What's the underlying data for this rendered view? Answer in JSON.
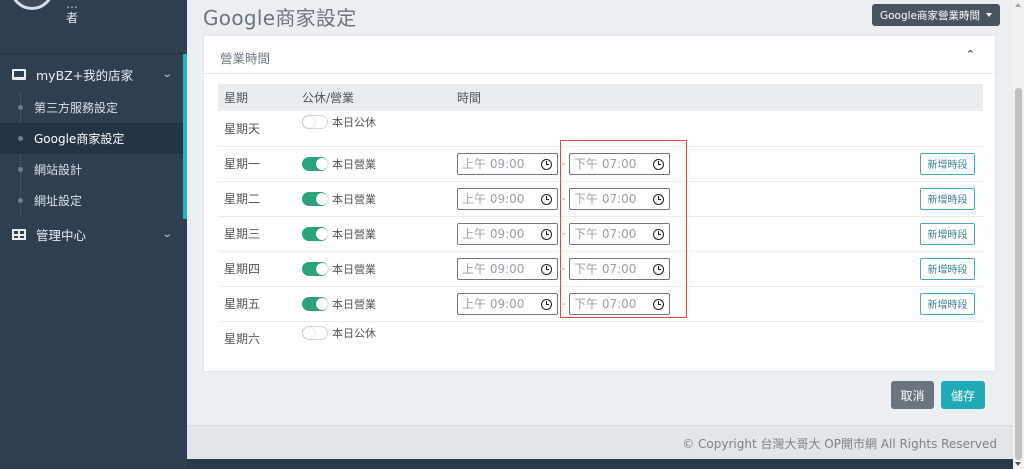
{
  "sidebar": {
    "profile_name": "…",
    "profile_role": "者",
    "groups": [
      {
        "label": "myBZ+我的店家",
        "icon": "monitor-icon"
      },
      {
        "label": "管理中心",
        "icon": "table-icon"
      }
    ],
    "sub_items": [
      "第三方服務設定",
      "Google商家設定",
      "網站設計",
      "網址設定"
    ],
    "active_item": "Google商家設定"
  },
  "header": {
    "title": "Google商家設定",
    "dropdown_label": "Google商家營業時間"
  },
  "panel": {
    "title": "營業時間",
    "collapse_icon": "chevron-up-icon",
    "columns": [
      "星期",
      "公休/營業",
      "時間"
    ],
    "rows": [
      {
        "day": "星期天",
        "open": false,
        "status": "本日公休"
      },
      {
        "day": "星期一",
        "open": true,
        "status": "本日營業",
        "start": "上午 09:00",
        "end": "下午 07:00",
        "add_label": "新增時段"
      },
      {
        "day": "星期二",
        "open": true,
        "status": "本日營業",
        "start": "上午 09:00",
        "end": "下午 07:00",
        "add_label": "新增時段"
      },
      {
        "day": "星期三",
        "open": true,
        "status": "本日營業",
        "start": "上午 09:00",
        "end": "下午 07:00",
        "add_label": "新增時段"
      },
      {
        "day": "星期四",
        "open": true,
        "status": "本日營業",
        "start": "上午 09:00",
        "end": "下午 07:00",
        "add_label": "新增時段"
      },
      {
        "day": "星期五",
        "open": true,
        "status": "本日營業",
        "start": "上午 09:00",
        "end": "下午 07:00",
        "add_label": "新增時段"
      },
      {
        "day": "星期六",
        "open": false,
        "status": "本日公休"
      }
    ]
  },
  "actions": {
    "cancel_label": "取消",
    "save_label": "儲存"
  },
  "footer": {
    "copyright": "© Copyright 台灣大哥大 OP開市網 All Rights Reserved"
  },
  "colors": {
    "sidebar_bg": "#2f3f50",
    "accent": "#1fb5c4",
    "toggle_on": "#2aa57a",
    "save": "#20aab8",
    "cancel": "#6b7580",
    "highlight": "#e0454a"
  }
}
